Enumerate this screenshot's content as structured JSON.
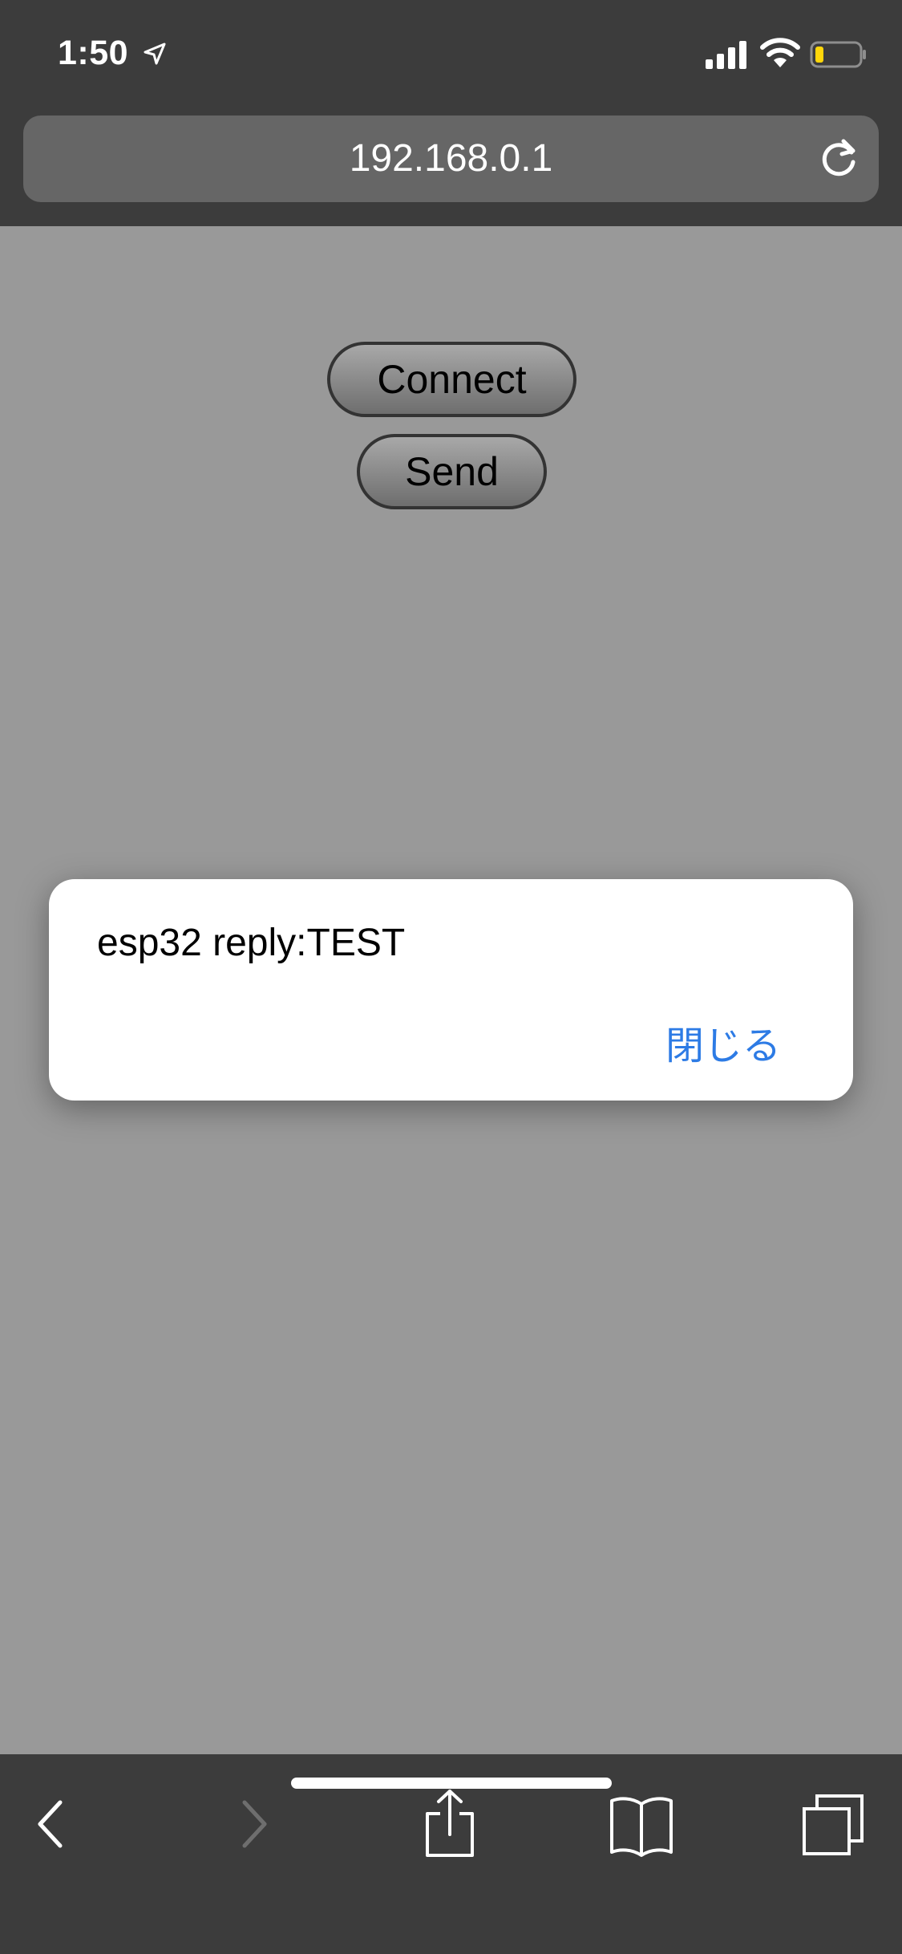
{
  "status_bar": {
    "time": "1:50",
    "icons": [
      "location-arrow-icon",
      "cellular-signal-icon",
      "wifi-icon",
      "battery-low-icon"
    ],
    "battery_color": "#ffd60a"
  },
  "address_bar": {
    "url": "192.168.0.1",
    "reload_icon": "reload-icon"
  },
  "page": {
    "connect_label": "Connect",
    "send_label": "Send",
    "background_color": "#999999"
  },
  "alert": {
    "message": "esp32 reply:TEST",
    "close_label": "閉じる",
    "button_color": "#2d7be5"
  },
  "toolbar": {
    "items": [
      {
        "icon": "back-chevron-icon",
        "enabled": true
      },
      {
        "icon": "forward-chevron-icon",
        "enabled": false
      },
      {
        "icon": "share-icon",
        "enabled": true
      },
      {
        "icon": "bookmarks-icon",
        "enabled": true
      },
      {
        "icon": "tabs-icon",
        "enabled": true
      }
    ]
  }
}
